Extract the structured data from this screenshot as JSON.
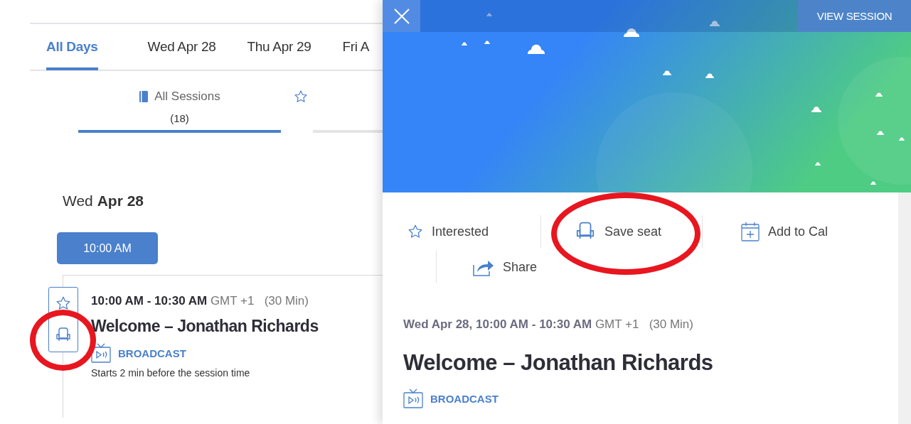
{
  "day_tabs": [
    {
      "label": "All Days",
      "selected": true
    },
    {
      "label": "Wed Apr 28",
      "selected": false
    },
    {
      "label": "Thu Apr 29",
      "selected": false
    },
    {
      "label": "Fri A",
      "selected": false
    }
  ],
  "session_filters": [
    {
      "kind": "book",
      "label": "All Sessions",
      "count": "(18)",
      "selected": true
    },
    {
      "kind": "star",
      "selected": false
    }
  ],
  "date_heading": {
    "weekday": "Wed",
    "day": "Apr 28"
  },
  "time_slot": "10:00 AM",
  "session": {
    "time": "10:00 AM - 10:30 AM",
    "timezone": "GMT +1",
    "duration": "(30 Min)",
    "title": "Welcome – Jonathan Richards",
    "type": "BROADCAST",
    "note": "Starts 2 min before the session time",
    "seat_highlighted": true
  },
  "detail_panel": {
    "view_button": "VIEW SESSION",
    "actions": [
      {
        "kind": "star",
        "label": "Interested",
        "highlighted": false
      },
      {
        "kind": "seat",
        "label": "Save seat",
        "highlighted": true
      },
      {
        "kind": "calendar",
        "label": "Add to Cal",
        "highlighted": false
      },
      {
        "kind": "share",
        "label": "Share",
        "highlighted": false
      }
    ],
    "date_time": "Wed Apr 28, 10:00 AM - 10:30 AM",
    "timezone": "GMT +1",
    "duration": "(30 Min)",
    "title": "Welcome – Jonathan Richards",
    "type": "BROADCAST"
  }
}
